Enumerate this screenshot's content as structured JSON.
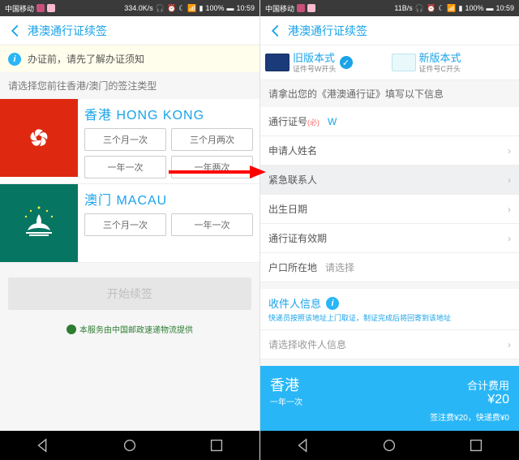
{
  "status": {
    "carrier": "中国移动",
    "net_left": "334.0K/s",
    "net_right": "11B/s",
    "battery": "100%",
    "time": "10:59"
  },
  "header": {
    "title": "港澳通行证续签"
  },
  "left": {
    "notice": "办证前，请先了解办证须知",
    "select_type_label": "请选择您前往香港/澳门的签注类型",
    "hk": {
      "name": "香港 HONG KONG",
      "opts": [
        "三个月一次",
        "三个月两次",
        "一年一次",
        "一年两次"
      ]
    },
    "macau": {
      "name": "澳门 MACAU",
      "opts": [
        "三个月一次",
        "一年一次"
      ]
    },
    "cta": "开始续签",
    "provider": "本服务由中国邮政速递物流提供"
  },
  "right": {
    "cards": {
      "old": {
        "title": "旧版本式",
        "sub": "证件号W开头"
      },
      "new": {
        "title": "新版本式",
        "sub": "证件号C开头"
      }
    },
    "instruction": "请拿出您的《港澳通行证》填写以下信息",
    "fields": {
      "permit_no_label": "通行证号",
      "permit_no_prefix": "W",
      "applicant_label": "申请人姓名",
      "emergency_label": "紧急联系人",
      "birth_label": "出生日期",
      "expiry_label": "通行证有效期",
      "hukou_label": "户口所在地",
      "hukou_placeholder": "请选择"
    },
    "recipient": {
      "header": "收件人信息",
      "sub": "快递员按照该地址上门取证，制证完成后将回寄到该地址",
      "select_label": "请选择收件人信息"
    },
    "summary": {
      "dest": "香港",
      "freq": "一年一次",
      "total_label": "合计费用",
      "total_value": "¥20",
      "detail": "签注费¥20，快递费¥0"
    }
  }
}
